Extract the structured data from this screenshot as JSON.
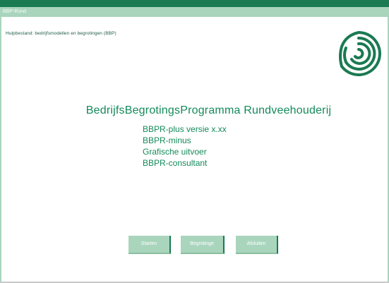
{
  "window": {
    "title": "BBP-Rund"
  },
  "status": {
    "text": "Hulpbestand: bedrijfsmodellen en begrotingen (BBP)"
  },
  "main": {
    "title": "BedrijfsBegrotingsProgramma Rundveehouderij",
    "items": [
      "BBPR-plus versie x.xx",
      "BBPR-minus",
      "Grafische uitvoer",
      "BBPR-consultant"
    ]
  },
  "buttons": {
    "start_label": "Starten",
    "begroting_label": "Begrotinge",
    "afsluiten_label": "Afsluiten"
  },
  "colors": {
    "accent": "#1a7a52",
    "light_accent": "#a9d5bd",
    "text_green": "#138a5a"
  },
  "icons": {
    "logo": "circular-maze-logo"
  }
}
